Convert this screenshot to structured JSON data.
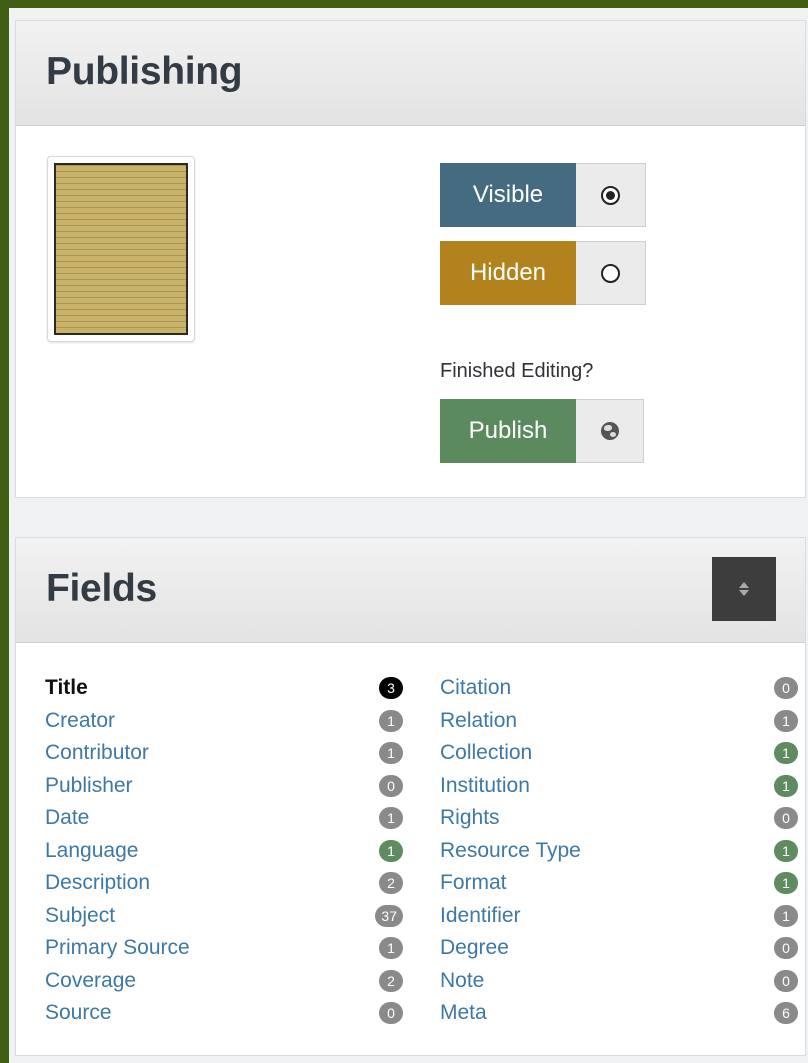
{
  "publishing": {
    "title": "Publishing",
    "visible_label": "Visible",
    "hidden_label": "Hidden",
    "finished_text": "Finished Editing?",
    "publish_label": "Publish",
    "selected": "visible",
    "colors": {
      "visible": "#456b80",
      "hidden": "#b2821c",
      "publish": "#5b8a5f"
    }
  },
  "fields": {
    "title": "Fields",
    "left": [
      {
        "name": "Title",
        "count": "3",
        "badge": "black",
        "active": true
      },
      {
        "name": "Creator",
        "count": "1",
        "badge": "gray"
      },
      {
        "name": "Contributor",
        "count": "1",
        "badge": "gray"
      },
      {
        "name": "Publisher",
        "count": "0",
        "badge": "gray"
      },
      {
        "name": "Date",
        "count": "1",
        "badge": "gray"
      },
      {
        "name": "Language",
        "count": "1",
        "badge": "green"
      },
      {
        "name": "Description",
        "count": "2",
        "badge": "gray"
      },
      {
        "name": "Subject",
        "count": "37",
        "badge": "gray"
      },
      {
        "name": "Primary Source",
        "count": "1",
        "badge": "gray"
      },
      {
        "name": "Coverage",
        "count": "2",
        "badge": "gray"
      },
      {
        "name": "Source",
        "count": "0",
        "badge": "gray"
      }
    ],
    "right": [
      {
        "name": "Citation",
        "count": "0",
        "badge": "gray"
      },
      {
        "name": "Relation",
        "count": "1",
        "badge": "gray"
      },
      {
        "name": "Collection",
        "count": "1",
        "badge": "green"
      },
      {
        "name": "Institution",
        "count": "1",
        "badge": "green"
      },
      {
        "name": "Rights",
        "count": "0",
        "badge": "gray"
      },
      {
        "name": "Resource Type",
        "count": "1",
        "badge": "green"
      },
      {
        "name": "Format",
        "count": "1",
        "badge": "green"
      },
      {
        "name": "Identifier",
        "count": "1",
        "badge": "gray"
      },
      {
        "name": "Degree",
        "count": "0",
        "badge": "gray"
      },
      {
        "name": "Note",
        "count": "0",
        "badge": "gray"
      },
      {
        "name": "Meta",
        "count": "6",
        "badge": "gray"
      }
    ]
  }
}
